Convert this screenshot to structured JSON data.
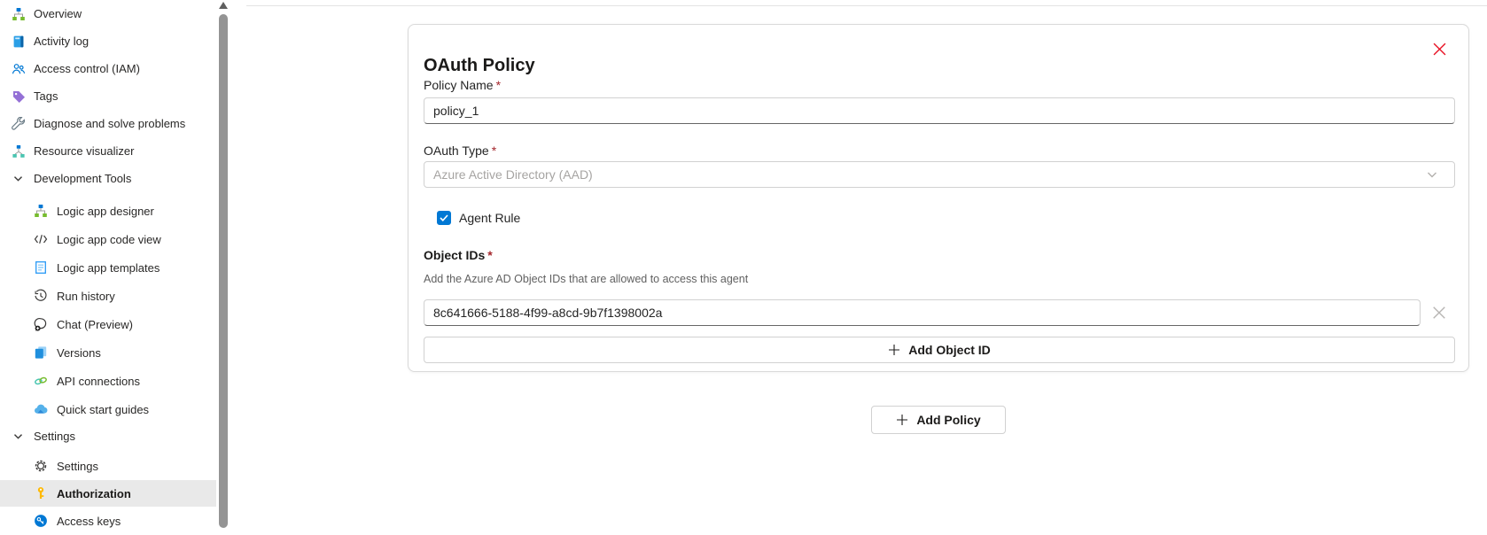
{
  "sidebar": {
    "items": [
      {
        "label": "Overview",
        "icon": "overview",
        "kind": "item",
        "level": 0,
        "selected": false
      },
      {
        "label": "Activity log",
        "icon": "activity-log",
        "kind": "item",
        "level": 0,
        "selected": false
      },
      {
        "label": "Access control (IAM)",
        "icon": "access-control",
        "kind": "item",
        "level": 0,
        "selected": false
      },
      {
        "label": "Tags",
        "icon": "tags",
        "kind": "item",
        "level": 0,
        "selected": false
      },
      {
        "label": "Diagnose and solve problems",
        "icon": "diagnose-wrench",
        "kind": "item",
        "level": 0,
        "selected": false
      },
      {
        "label": "Resource visualizer",
        "icon": "resource-visualizer",
        "kind": "item",
        "level": 0,
        "selected": false
      },
      {
        "label": "Development Tools",
        "icon": "chevron-down",
        "kind": "group",
        "level": 0,
        "selected": false
      },
      {
        "label": "Logic app designer",
        "icon": "logic-app-designer",
        "kind": "item",
        "level": 1,
        "selected": false
      },
      {
        "label": "Logic app code view",
        "icon": "code-view",
        "kind": "item",
        "level": 1,
        "selected": false
      },
      {
        "label": "Logic app templates",
        "icon": "templates",
        "kind": "item",
        "level": 1,
        "selected": false
      },
      {
        "label": "Run history",
        "icon": "run-history",
        "kind": "item",
        "level": 1,
        "selected": false
      },
      {
        "label": "Chat (Preview)",
        "icon": "chat",
        "kind": "item",
        "level": 1,
        "selected": false
      },
      {
        "label": "Versions",
        "icon": "versions",
        "kind": "item",
        "level": 1,
        "selected": false
      },
      {
        "label": "API connections",
        "icon": "api-connections",
        "kind": "item",
        "level": 1,
        "selected": false
      },
      {
        "label": "Quick start guides",
        "icon": "quick-start",
        "kind": "item",
        "level": 1,
        "selected": false
      },
      {
        "label": "Settings",
        "icon": "chevron-down",
        "kind": "group",
        "level": 0,
        "selected": false
      },
      {
        "label": "Settings",
        "icon": "settings-gear",
        "kind": "item",
        "level": 1,
        "selected": false
      },
      {
        "label": "Authorization",
        "icon": "authorization-key",
        "kind": "item",
        "level": 1,
        "selected": true
      },
      {
        "label": "Access keys",
        "icon": "access-keys",
        "kind": "item",
        "level": 1,
        "selected": false
      }
    ]
  },
  "dialog": {
    "title": "OAuth Policy",
    "required_marker": "*",
    "policy_name": {
      "label": "Policy Name",
      "required": true,
      "value": "policy_1"
    },
    "oauth_type": {
      "label": "OAuth Type",
      "required": true,
      "placeholder": "Azure Active Directory (AAD)"
    },
    "agent_rule": {
      "label": "Agent Rule",
      "checked": true
    },
    "object_ids": {
      "label": "Object IDs",
      "required": true,
      "description": "Add the Azure AD Object IDs that are allowed to access this agent",
      "values": [
        "8c641666-5188-4f99-a8cd-9b7f1398002a"
      ],
      "add_button_label": "Add Object ID"
    }
  },
  "actions": {
    "add_policy_label": "Add Policy"
  },
  "colors": {
    "accent_blue": "#0078d4",
    "close_red": "#e81123",
    "required_red": "#a4262c",
    "selected_row_bg": "#e9e9e9",
    "key_yellow": "#ffb900"
  }
}
